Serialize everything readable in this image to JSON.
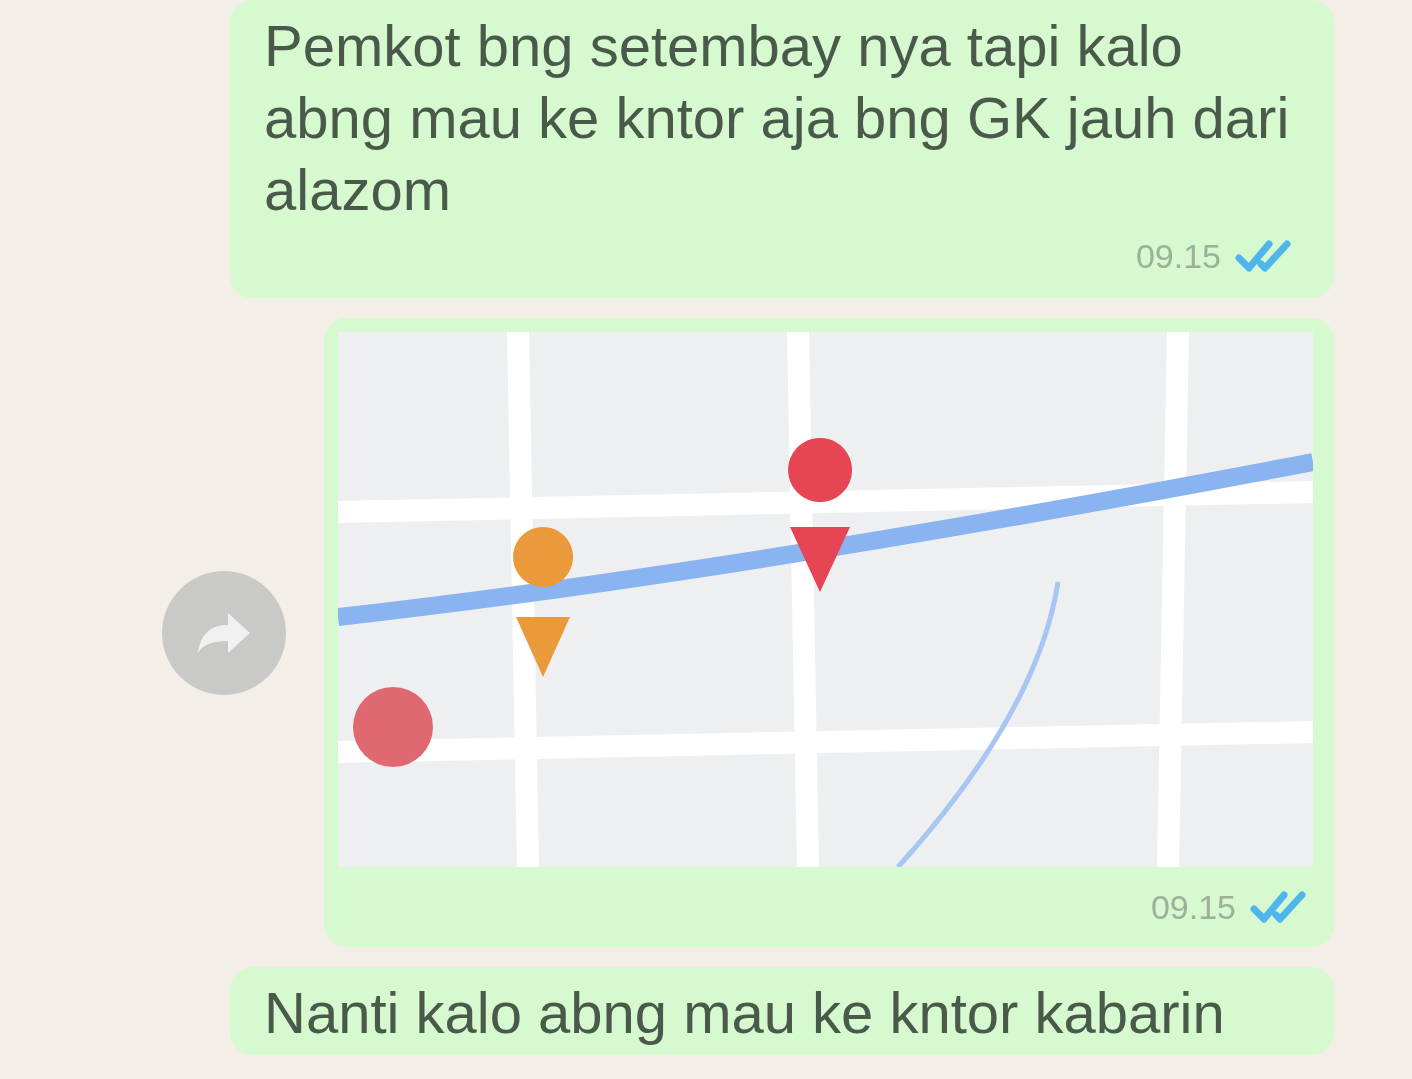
{
  "messages": [
    {
      "kind": "text",
      "text": "Pemkot bng setembay nya tapi kalo abng mau ke kntor aja bng GK jauh dari alazom",
      "time": "09.15",
      "read": true
    },
    {
      "kind": "location",
      "time": "09.15",
      "read": true,
      "forward": true
    },
    {
      "kind": "text",
      "text": "Nanti kalo abng mau ke kntor kabarin"
    }
  ]
}
